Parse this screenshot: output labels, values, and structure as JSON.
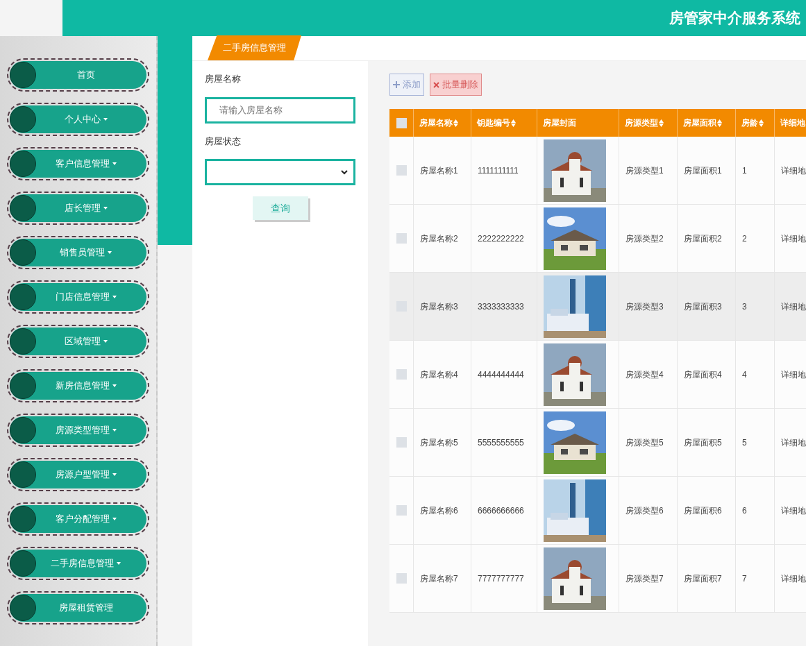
{
  "header": {
    "title": "房管家中介服务系统"
  },
  "sidebar": {
    "items": [
      {
        "label": "首页",
        "has_caret": false
      },
      {
        "label": "个人中心",
        "has_caret": true
      },
      {
        "label": "客户信息管理",
        "has_caret": true
      },
      {
        "label": "店长管理",
        "has_caret": true
      },
      {
        "label": "销售员管理",
        "has_caret": true
      },
      {
        "label": "门店信息管理",
        "has_caret": true
      },
      {
        "label": "区域管理",
        "has_caret": true
      },
      {
        "label": "新房信息管理",
        "has_caret": true
      },
      {
        "label": "房源类型管理",
        "has_caret": true
      },
      {
        "label": "房源户型管理",
        "has_caret": true
      },
      {
        "label": "客户分配管理",
        "has_caret": true
      },
      {
        "label": "二手房信息管理",
        "has_caret": true
      },
      {
        "label": "房屋租赁管理",
        "has_caret": false
      }
    ]
  },
  "tab": {
    "label": "二手房信息管理"
  },
  "search": {
    "fields": [
      {
        "kind": "text",
        "label": "房屋名称",
        "placeholder": "请输入房屋名称"
      },
      {
        "kind": "select",
        "label": "房屋状态"
      }
    ],
    "button": "查询"
  },
  "toolbar": {
    "add": "添加",
    "batch_delete": "批量删除"
  },
  "table": {
    "select_all": {
      "checked": false
    },
    "columns": [
      {
        "label": "房屋名称",
        "sortable": true
      },
      {
        "label": "钥匙编号",
        "sortable": true
      },
      {
        "label": "房屋封面",
        "sortable": false
      },
      {
        "label": "房源类型",
        "sortable": true
      },
      {
        "label": "房屋面积",
        "sortable": true
      },
      {
        "label": "房龄",
        "sortable": true
      },
      {
        "label": "详细地"
      }
    ],
    "rows": [
      {
        "checked": false,
        "highlighted": false,
        "cells": [
          "房屋名称1",
          "1111111111",
          {
            "kind": "picture"
          },
          "房源类型1",
          "房屋面积1",
          "1",
          "详细地"
        ]
      },
      {
        "checked": false,
        "highlighted": false,
        "cells": [
          "房屋名称2",
          "2222222222",
          {
            "kind": "picture"
          },
          "房源类型2",
          "房屋面积2",
          "2",
          "详细地"
        ]
      },
      {
        "checked": false,
        "highlighted": true,
        "cells": [
          "房屋名称3",
          "3333333333",
          {
            "kind": "picture"
          },
          "房源类型3",
          "房屋面积3",
          "3",
          "详细地"
        ]
      },
      {
        "checked": false,
        "highlighted": false,
        "cells": [
          "房屋名称4",
          "4444444444",
          {
            "kind": "picture"
          },
          "房源类型4",
          "房屋面积4",
          "4",
          "详细地"
        ]
      },
      {
        "checked": false,
        "highlighted": false,
        "cells": [
          "房屋名称5",
          "5555555555",
          {
            "kind": "picture"
          },
          "房源类型5",
          "房屋面积5",
          "5",
          "详细地"
        ]
      },
      {
        "checked": false,
        "highlighted": false,
        "cells": [
          "房屋名称6",
          "6666666666",
          {
            "kind": "picture"
          },
          "房源类型6",
          "房屋面积6",
          "6",
          "详细地"
        ]
      },
      {
        "checked": false,
        "highlighted": false,
        "cells": [
          "房屋名称7",
          "7777777777",
          {
            "kind": "picture"
          },
          "房源类型7",
          "房屋面积7",
          "7",
          "详细地"
        ]
      }
    ]
  }
}
